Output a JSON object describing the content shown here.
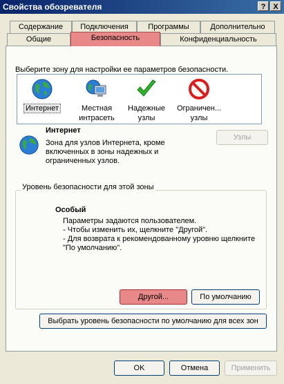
{
  "window": {
    "title": "Свойства обозревателя",
    "help_label": "?",
    "close_label": "X"
  },
  "tabs_row1": [
    "Содержание",
    "Подключения",
    "Программы",
    "Дополнительно"
  ],
  "tabs_row2": [
    "Общие",
    "Безопасность",
    "Конфиденциальность"
  ],
  "active_tab": "Безопасность",
  "zones_prompt": "Выберите зону для настройки ее параметров безопасности.",
  "zones": [
    {
      "label_line1": "Интернет",
      "label_line2": "",
      "icon": "globe-icon",
      "selected": true
    },
    {
      "label_line1": "Местная",
      "label_line2": "интрасеть",
      "icon": "intranet-icon",
      "selected": false
    },
    {
      "label_line1": "Надежные",
      "label_line2": "узлы",
      "icon": "checkmark-icon",
      "selected": false
    },
    {
      "label_line1": "Ограничен...",
      "label_line2": "узлы",
      "icon": "restricted-icon",
      "selected": false
    }
  ],
  "zone_info": {
    "title": "Интернет",
    "description_lines": [
      "Зона для узлов Интернета, кроме",
      "включенных в зоны надежных и",
      "ограниченных узлов."
    ],
    "sites_button": "Узлы"
  },
  "security_level": {
    "group_label": "Уровень безопасности для этой зоны",
    "level_title": "Особый",
    "lines": [
      "Параметры задаются пользователем.",
      "- Чтобы изменить их, щелкните \"Другой\".",
      "- Для возврата к рекомендованному уровню щелкните",
      "\"По умолчанию\"."
    ],
    "custom_button": "Другой...",
    "default_button": "По умолчанию"
  },
  "reset_all_button": "Выбрать уровень безопасности по умолчанию для всех зон",
  "footer": {
    "ok": "OK",
    "cancel": "Отмена",
    "apply": "Применить"
  },
  "colors": {
    "titlebar": "#0a246a",
    "highlight": "#e98888",
    "dialog_bg": "#ece9d8"
  }
}
